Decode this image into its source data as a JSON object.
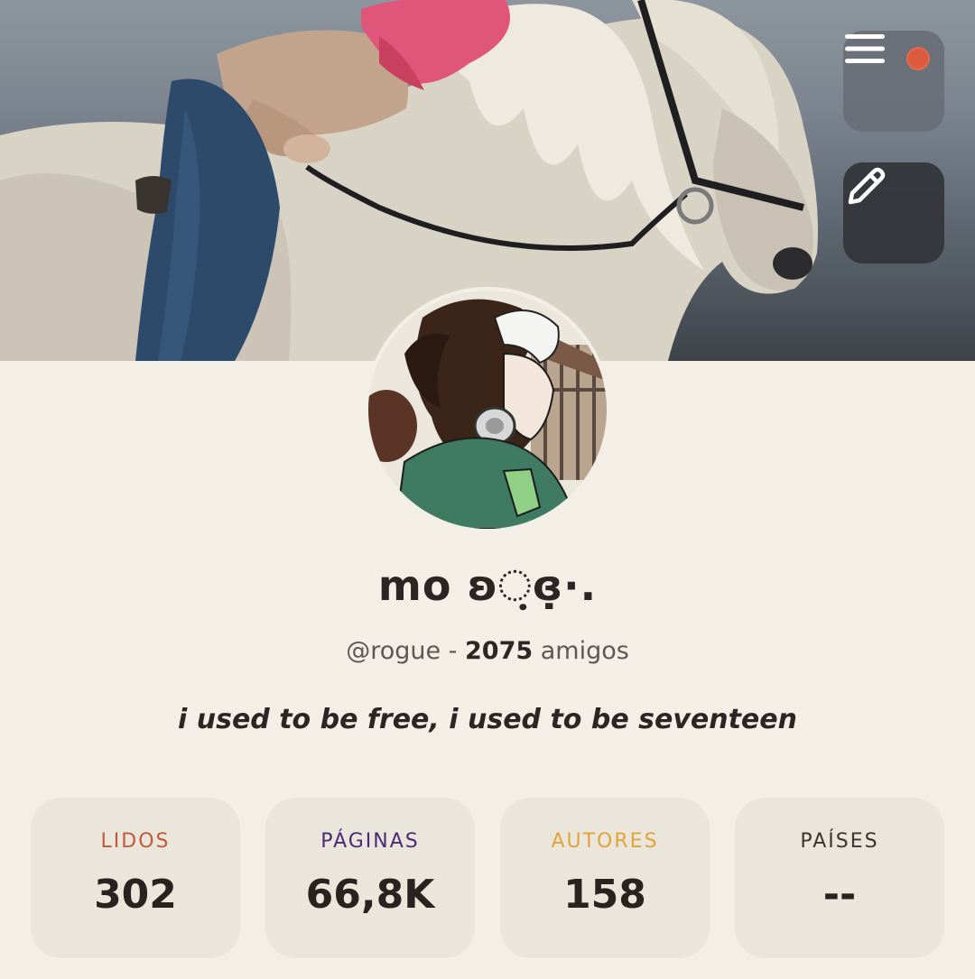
{
  "header": {
    "menu_icon": "hamburger-menu-icon",
    "has_notification": true,
    "notification_color": "#dc5a3d",
    "edit_icon": "pencil-icon"
  },
  "profile": {
    "display_name": "mo ʚ଼ɞ̣̣·.",
    "handle": "@rogue",
    "separator": " - ",
    "friends_count": "2075",
    "friends_label": " amigos",
    "bio": "i used to be free, i used to be seventeen"
  },
  "stats": [
    {
      "label": "LIDOS",
      "value": "302",
      "color": "#c25a3a"
    },
    {
      "label": "PÁGINAS",
      "value": "66,8K",
      "color": "#4b2a78"
    },
    {
      "label": "AUTORES",
      "value": "158",
      "color": "#e2a33a"
    },
    {
      "label": "PAÍSES",
      "value": "--",
      "color": "#3a3531"
    }
  ]
}
